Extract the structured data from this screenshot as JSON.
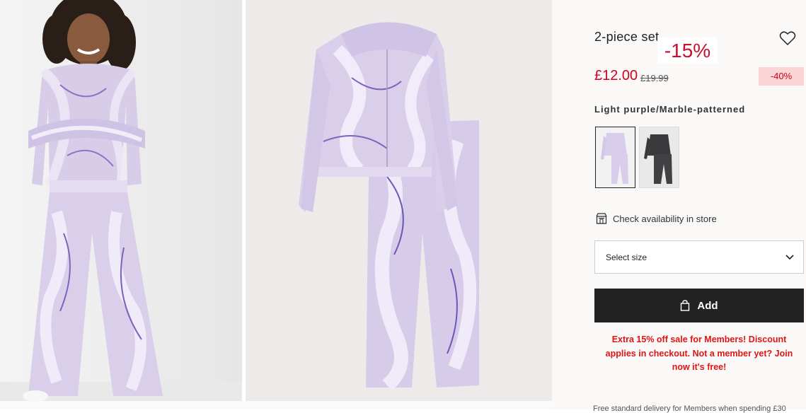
{
  "product": {
    "title": "2-piece set",
    "price": "£12.00",
    "old_price": "£19.99",
    "discount": "-40%",
    "promo_overlay": "-15%",
    "color": "Light purple/Marble-patterned"
  },
  "swatches": [
    {
      "name": "Light purple/Marble-patterned",
      "selected": true
    },
    {
      "name": "Dark grey",
      "selected": false
    }
  ],
  "store": {
    "label": "Check availability in store",
    "icon": "store-icon"
  },
  "size_select": {
    "placeholder": "Select size",
    "icon": "chevron-down-icon"
  },
  "add_button": {
    "label": "Add",
    "icon": "shopping-bag-icon"
  },
  "member_message": "Extra 15% off sale for Members! Discount applies in checkout. Not a member yet? Join now it's free!",
  "footer_text": "Free standard delivery for Members when spending £30",
  "colors": {
    "sale_red": "#d0021b",
    "promo_red": "#e11414",
    "add_button_bg": "#222222",
    "badge_bg": "#fbd5d5"
  }
}
